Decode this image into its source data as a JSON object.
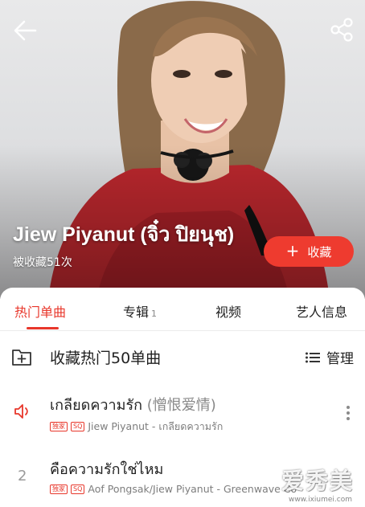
{
  "header": {
    "artist_name": "Jiew Piyanut (จิ๋ว ปิยนุช)",
    "favorites_text": "被收藏51次",
    "collect_button": "收藏",
    "icons": {
      "back": "back-arrow-icon",
      "share": "share-icon"
    }
  },
  "tabs": [
    {
      "label": "热门单曲",
      "badge": "",
      "active": true
    },
    {
      "label": "专辑",
      "badge": "1",
      "active": false
    },
    {
      "label": "视频",
      "badge": "",
      "active": false
    },
    {
      "label": "艺人信息",
      "badge": "",
      "active": false
    }
  ],
  "hot_section": {
    "title": "收藏热门50单曲",
    "manage_label": "管理"
  },
  "songs": [
    {
      "index": "",
      "title": "เกลียดความรัก",
      "alt_title": "(憎恨爱情)",
      "tags": [
        "独家",
        "SQ"
      ],
      "subtitle": "Jiew Piyanut - เกลียดความรัก",
      "playing": true
    },
    {
      "index": "2",
      "title": "คือความรักใช่ไหม",
      "alt_title": "",
      "tags": [
        "独家",
        "SQ"
      ],
      "subtitle": "Aof Pongsak/Jiew Piyanut - Greenwave Co",
      "playing": false
    }
  ],
  "watermark": {
    "text": "爱秀美",
    "sub": "www.ixiumei.com"
  },
  "colors": {
    "accent": "#e8372b",
    "collect_button": "#ee3b2f"
  }
}
